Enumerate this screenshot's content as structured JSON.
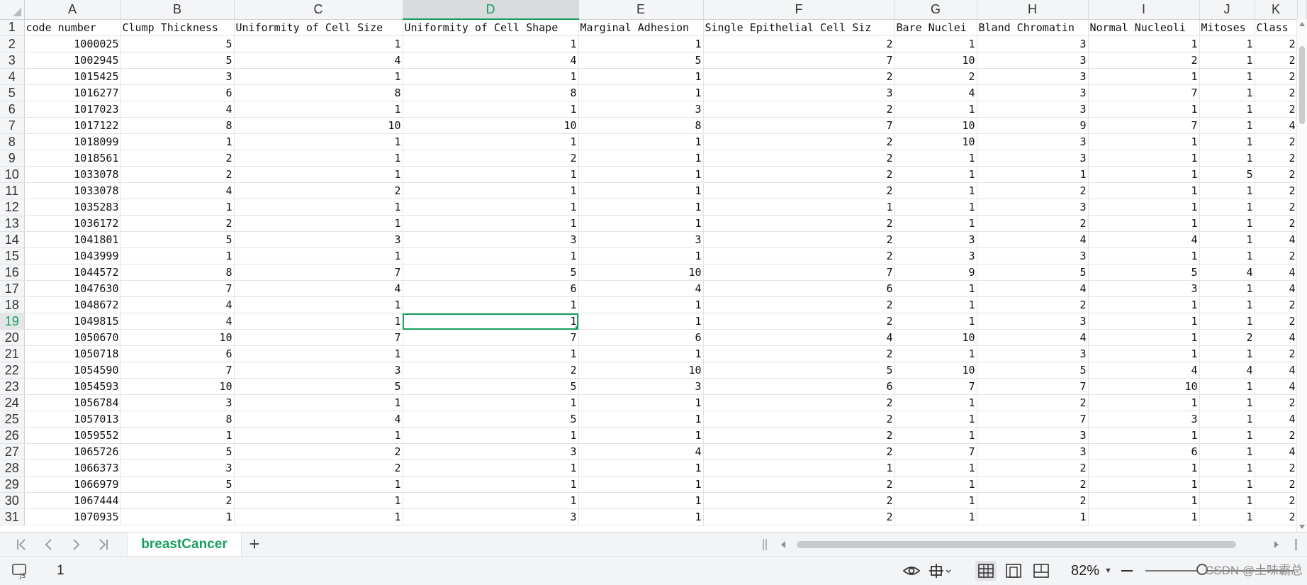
{
  "sheet": {
    "columns": [
      "A",
      "B",
      "C",
      "D",
      "E",
      "F",
      "G",
      "H",
      "I",
      "J",
      "K"
    ],
    "selected_column": "D",
    "selected_row": 19,
    "header_row": [
      "code number",
      "Clump Thickness",
      "Uniformity of Cell Size",
      "Uniformity of Cell Shape",
      "Marginal Adhesion",
      "Single Epithelial Cell Siz",
      "Bare Nuclei",
      "Bland Chromatin",
      "Normal Nucleoli",
      "Mitoses",
      "Class"
    ],
    "rows": [
      [
        "1000025",
        "5",
        "1",
        "1",
        "1",
        "2",
        "1",
        "3",
        "1",
        "1",
        "2"
      ],
      [
        "1002945",
        "5",
        "4",
        "4",
        "5",
        "7",
        "10",
        "3",
        "2",
        "1",
        "2"
      ],
      [
        "1015425",
        "3",
        "1",
        "1",
        "1",
        "2",
        "2",
        "3",
        "1",
        "1",
        "2"
      ],
      [
        "1016277",
        "6",
        "8",
        "8",
        "1",
        "3",
        "4",
        "3",
        "7",
        "1",
        "2"
      ],
      [
        "1017023",
        "4",
        "1",
        "1",
        "3",
        "2",
        "1",
        "3",
        "1",
        "1",
        "2"
      ],
      [
        "1017122",
        "8",
        "10",
        "10",
        "8",
        "7",
        "10",
        "9",
        "7",
        "1",
        "4"
      ],
      [
        "1018099",
        "1",
        "1",
        "1",
        "1",
        "2",
        "10",
        "3",
        "1",
        "1",
        "2"
      ],
      [
        "1018561",
        "2",
        "1",
        "2",
        "1",
        "2",
        "1",
        "3",
        "1",
        "1",
        "2"
      ],
      [
        "1033078",
        "2",
        "1",
        "1",
        "1",
        "2",
        "1",
        "1",
        "1",
        "5",
        "2"
      ],
      [
        "1033078",
        "4",
        "2",
        "1",
        "1",
        "2",
        "1",
        "2",
        "1",
        "1",
        "2"
      ],
      [
        "1035283",
        "1",
        "1",
        "1",
        "1",
        "1",
        "1",
        "3",
        "1",
        "1",
        "2"
      ],
      [
        "1036172",
        "2",
        "1",
        "1",
        "1",
        "2",
        "1",
        "2",
        "1",
        "1",
        "2"
      ],
      [
        "1041801",
        "5",
        "3",
        "3",
        "3",
        "2",
        "3",
        "4",
        "4",
        "1",
        "4"
      ],
      [
        "1043999",
        "1",
        "1",
        "1",
        "1",
        "2",
        "3",
        "3",
        "1",
        "1",
        "2"
      ],
      [
        "1044572",
        "8",
        "7",
        "5",
        "10",
        "7",
        "9",
        "5",
        "5",
        "4",
        "4"
      ],
      [
        "1047630",
        "7",
        "4",
        "6",
        "4",
        "6",
        "1",
        "4",
        "3",
        "1",
        "4"
      ],
      [
        "1048672",
        "4",
        "1",
        "1",
        "1",
        "2",
        "1",
        "2",
        "1",
        "1",
        "2"
      ],
      [
        "1049815",
        "4",
        "1",
        "1",
        "1",
        "2",
        "1",
        "3",
        "1",
        "1",
        "2"
      ],
      [
        "1050670",
        "10",
        "7",
        "7",
        "6",
        "4",
        "10",
        "4",
        "1",
        "2",
        "4"
      ],
      [
        "1050718",
        "6",
        "1",
        "1",
        "1",
        "2",
        "1",
        "3",
        "1",
        "1",
        "2"
      ],
      [
        "1054590",
        "7",
        "3",
        "2",
        "10",
        "5",
        "10",
        "5",
        "4",
        "4",
        "4"
      ],
      [
        "1054593",
        "10",
        "5",
        "5",
        "3",
        "6",
        "7",
        "7",
        "10",
        "1",
        "4"
      ],
      [
        "1056784",
        "3",
        "1",
        "1",
        "1",
        "2",
        "1",
        "2",
        "1",
        "1",
        "2"
      ],
      [
        "1057013",
        "8",
        "4",
        "5",
        "1",
        "2",
        "1",
        "7",
        "3",
        "1",
        "4"
      ],
      [
        "1059552",
        "1",
        "1",
        "1",
        "1",
        "2",
        "1",
        "3",
        "1",
        "1",
        "2"
      ],
      [
        "1065726",
        "5",
        "2",
        "3",
        "4",
        "2",
        "7",
        "3",
        "6",
        "1",
        "4"
      ],
      [
        "1066373",
        "3",
        "2",
        "1",
        "1",
        "1",
        "1",
        "2",
        "1",
        "1",
        "2"
      ],
      [
        "1066979",
        "5",
        "1",
        "1",
        "1",
        "2",
        "1",
        "2",
        "1",
        "1",
        "2"
      ],
      [
        "1067444",
        "2",
        "1",
        "1",
        "1",
        "2",
        "1",
        "2",
        "1",
        "1",
        "2"
      ],
      [
        "1070935",
        "1",
        "1",
        "3",
        "1",
        "2",
        "1",
        "1",
        "1",
        "1",
        "2"
      ]
    ]
  },
  "tabs": {
    "sheet_name": "breastCancer",
    "add_symbol": "+"
  },
  "status": {
    "count": "1",
    "zoom": "82%",
    "watermark": "CSDN @土味霸总"
  },
  "icons": {
    "first": "first-sheet-icon",
    "prev": "prev-sheet-icon",
    "next": "next-sheet-icon",
    "last": "last-sheet-icon",
    "eye": "eye-protection-icon",
    "layout": "crosshair-icon",
    "normal": "normal-view-icon",
    "page_layout": "page-layout-view-icon",
    "page_break": "page-break-view-icon"
  },
  "colors": {
    "accent": "#17a05d"
  }
}
